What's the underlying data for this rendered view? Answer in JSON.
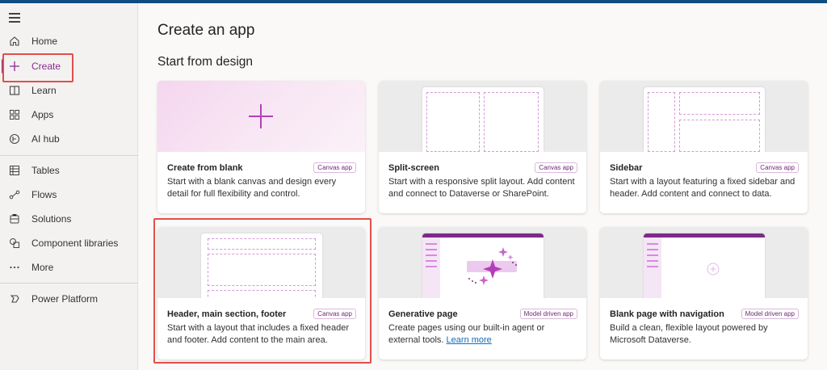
{
  "sidebar": {
    "items": [
      {
        "label": "Home",
        "icon": "home-icon"
      },
      {
        "label": "Create",
        "icon": "plus-icon",
        "active": true
      },
      {
        "label": "Learn",
        "icon": "book-icon"
      },
      {
        "label": "Apps",
        "icon": "apps-icon"
      },
      {
        "label": "AI hub",
        "icon": "ai-hub-icon"
      },
      {
        "label": "Tables",
        "icon": "table-icon"
      },
      {
        "label": "Flows",
        "icon": "flows-icon"
      },
      {
        "label": "Solutions",
        "icon": "solutions-icon"
      },
      {
        "label": "Component libraries",
        "icon": "component-icon"
      },
      {
        "label": "More",
        "icon": "more-icon"
      },
      {
        "label": "Power Platform",
        "icon": "power-platform-icon"
      }
    ]
  },
  "main": {
    "title": "Create an app",
    "section_title": "Start from design",
    "cards": [
      {
        "title": "Create from blank",
        "badge": "Canvas app",
        "description": "Start with a blank canvas and design every detail for full flexibility and control."
      },
      {
        "title": "Split-screen",
        "badge": "Canvas app",
        "description": "Start with a responsive split layout. Add content and connect to Dataverse or SharePoint."
      },
      {
        "title": "Sidebar",
        "badge": "Canvas app",
        "description": "Start with a layout featuring a fixed sidebar and header. Add content and connect to data."
      },
      {
        "title": "Header, main section, footer",
        "badge": "Canvas app",
        "description": "Start with a layout that includes a fixed header and footer. Add content to the main area."
      },
      {
        "title": "Generative page",
        "badge": "Model driven app",
        "description": "Create pages using our built-in agent or external tools.",
        "link": "Learn more"
      },
      {
        "title": "Blank page with navigation",
        "badge": "Model driven app",
        "description": "Build a clean, flexible layout powered by Microsoft Dataverse."
      }
    ]
  },
  "colors": {
    "accent": "#8a2a91",
    "highlight": "#e0504a",
    "topbar": "#0f4c81"
  }
}
